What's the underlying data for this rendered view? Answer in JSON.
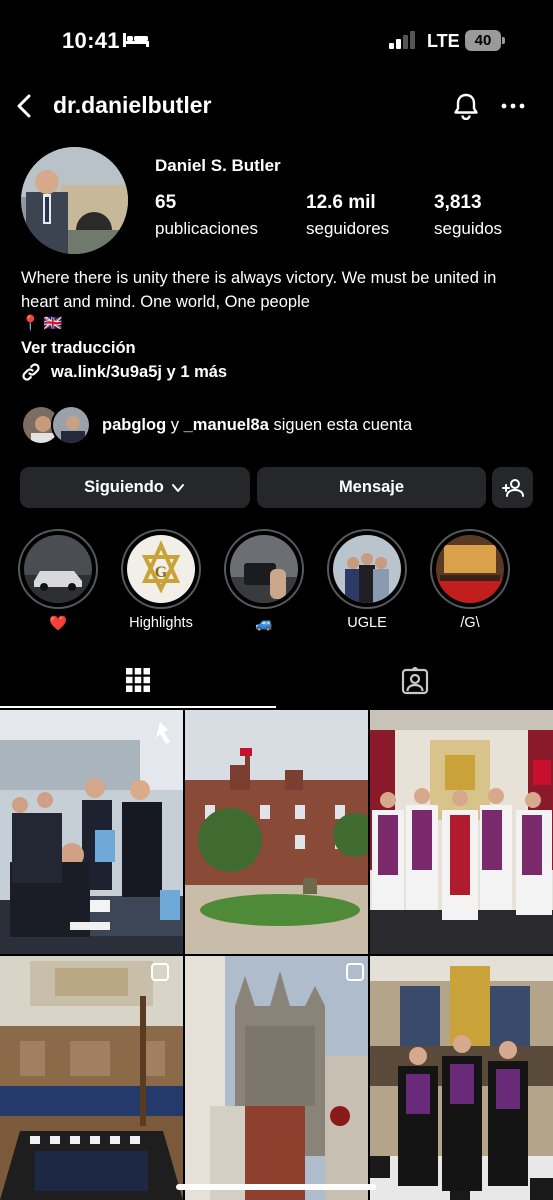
{
  "status_bar": {
    "time": "10:41",
    "network": "LTE",
    "battery": "40",
    "icons": [
      "bed-icon",
      "signal-icon"
    ]
  },
  "header": {
    "username": "dr.danielbutler",
    "icons": [
      "back-icon",
      "bell-icon",
      "more-icon"
    ]
  },
  "profile": {
    "full_name": "Daniel S. Butler",
    "posts_count": "65",
    "posts_label": "publicaciones",
    "followers_count": "12.6 mil",
    "followers_label": "seguidores",
    "following_count": "3,813",
    "following_label": "seguidos",
    "bio": "Where there is unity there is always victory. We must be united in heart and mind. One world, One people",
    "bio_emojis": "📍 🇬🇧",
    "translate": "Ver traducción",
    "link": "wa.link/3u9a5j y 1 más"
  },
  "followed_by": {
    "user1": "pabglog",
    "conj": "y",
    "user2": "_manuel8a",
    "suffix": "siguen esta cuenta"
  },
  "buttons": {
    "following": "Siguiendo",
    "message": "Mensaje"
  },
  "highlights": [
    {
      "label": "❤️"
    },
    {
      "label": "Highlights"
    },
    {
      "label": "🚙"
    },
    {
      "label": "UGLE"
    },
    {
      "label": "/G\\"
    }
  ],
  "tabs": [
    "grid-icon",
    "tagged-icon"
  ],
  "colors": {
    "background": "#000000",
    "button_bg": "#26272b",
    "ring": "#58595d"
  }
}
